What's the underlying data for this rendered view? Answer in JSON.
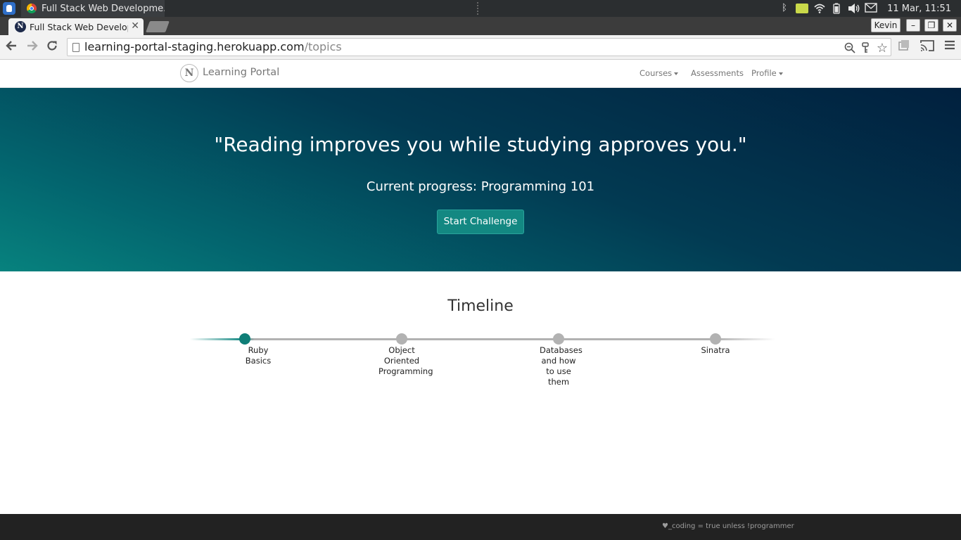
{
  "taskbar": {
    "task_title": "Full Stack Web Developme...",
    "clock": "11 Mar, 11:51"
  },
  "browser": {
    "tab_title": "Full Stack Web Developme",
    "tab_favicon": "N",
    "profile_name": "Kevin",
    "url_host": "learning-portal-staging.herokuapp.com",
    "url_path": "/topics"
  },
  "nav": {
    "brand_logo": "N",
    "brand": "Learning Portal",
    "links": [
      "Courses",
      "Assessments",
      "Profile"
    ]
  },
  "hero": {
    "quote": "\"Reading improves you while studying approves you.\"",
    "progress": "Current progress: Programming 101",
    "button": "Start Challenge"
  },
  "timeline": {
    "heading": "Timeline",
    "items": [
      {
        "label": "Ruby Basics",
        "status": "current"
      },
      {
        "label": "Object Oriented Programming",
        "status": "upcoming"
      },
      {
        "label": "Databases and how to use them",
        "status": "upcoming"
      },
      {
        "label": "Sinatra",
        "status": "upcoming"
      }
    ]
  },
  "footer": {
    "text": "♥_coding = true unless !programmer"
  },
  "colors": {
    "accent": "#138882",
    "hero_dark": "#01203e",
    "hero_teal": "#07827e",
    "footer_bg": "#222222"
  }
}
